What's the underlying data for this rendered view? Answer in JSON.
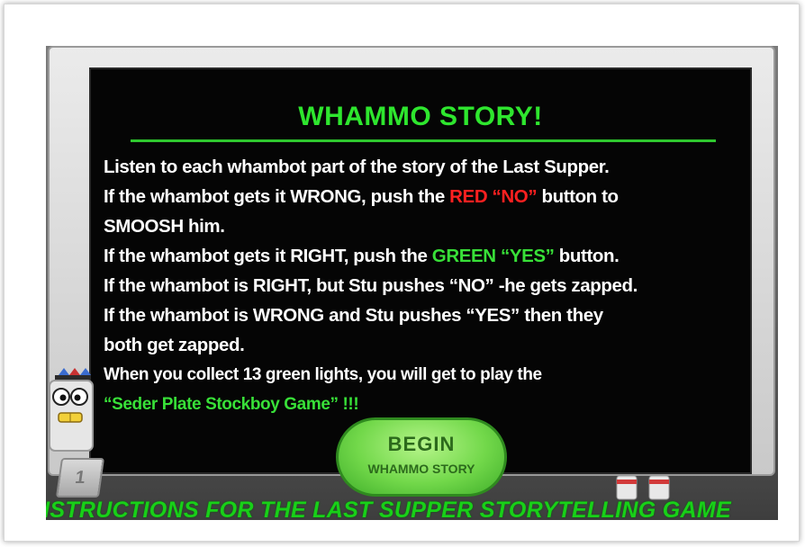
{
  "screen": {
    "title": "WHAMMO STORY!",
    "lines": {
      "l1": "Listen to each whambot part of the story of the Last Supper.",
      "l2_pre": "If the whambot gets it  WRONG, push the ",
      "l2_red": "RED “NO”",
      "l2_post": " button to",
      "l3": "SMOOSH him.",
      "l4_pre": "If the whambot gets it RIGHT, push the ",
      "l4_green": "GREEN “YES”",
      "l4_post": " button.",
      "l5": "If the whambot is RIGHT, but Stu pushes “NO” -he gets zapped.",
      "l6": "If the whambot is WRONG and Stu pushes “YES” then  they",
      "l7": "both get zapped.",
      "l8": "When you collect 13 green lights, you will get to play the",
      "l9_green": "“Seder Plate Stockboy Game”",
      "l9_post": " !!!"
    }
  },
  "begin_button": {
    "line1": "BEGIN",
    "line2": "WHAMMO STORY"
  },
  "pad_number": "1",
  "footer": "NSTRUCTIONS FOR THE LAST SUPPER STORYTELLING GAME",
  "colors": {
    "title_green": "#2ee62e",
    "red": "#ff2020",
    "footer_green": "#18d018"
  }
}
